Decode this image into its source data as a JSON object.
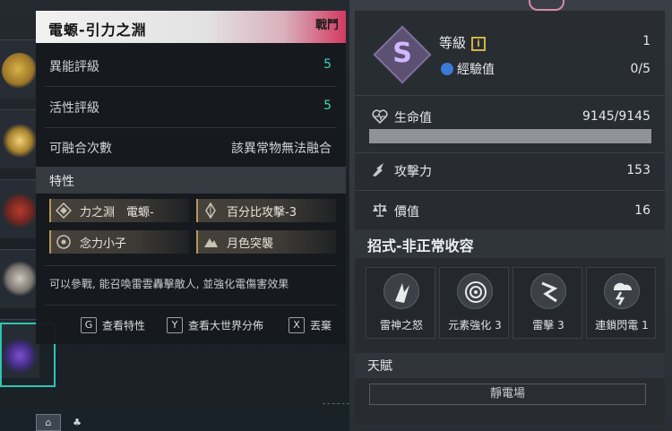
{
  "detail": {
    "title": "電螈-引力之淵",
    "tag": "戰鬥",
    "stats": [
      {
        "label": "異能評級",
        "value": "5"
      },
      {
        "label": "活性評級",
        "value": "5"
      },
      {
        "label": "可融合次數",
        "value": "該異常物無法融合"
      }
    ],
    "traits_heading": "特性",
    "traits": [
      {
        "label": "力之淵　電螈-",
        "icon": "diamond-icon"
      },
      {
        "label": "百分比攻擊-3",
        "icon": "crystal-icon"
      },
      {
        "label": "念力小子",
        "icon": "crosshair-icon"
      },
      {
        "label": "月色突襲",
        "icon": "mountain-icon"
      }
    ],
    "description": "可以參戰, 能召喚雷雲轟擊敵人, 並強化電傷害效果",
    "footer": [
      {
        "key": "G",
        "label": "查看特性"
      },
      {
        "key": "Y",
        "label": "查看大世界分佈"
      },
      {
        "key": "X",
        "label": "丟棄"
      }
    ]
  },
  "stats_panel": {
    "rank": "S",
    "level_label": "等級",
    "level_badge": "i",
    "level_value": "1",
    "xp_label": "經驗值",
    "xp_value": "0/5",
    "hp_label": "生命值",
    "hp_value": "9145/9145",
    "hp_fill": 1.0,
    "attack_label": "攻擊力",
    "attack_value": "153",
    "price_label": "價值",
    "price_value": "16",
    "moves_heading": "招式-非正常收容",
    "moves": [
      {
        "label": "雷神之怒",
        "icon": "thunder-god-icon"
      },
      {
        "label": "元素強化 3",
        "icon": "vortex-icon"
      },
      {
        "label": "雷擊 3",
        "icon": "lightning-icon"
      },
      {
        "label": "連鎖閃電 1",
        "icon": "chain-lightning-icon"
      }
    ],
    "talent_heading": "天賦",
    "talent_value": "靜電場"
  },
  "colors": {
    "accent_teal": "#3fd3bc",
    "header_red": "#d23a62",
    "rank_purple": "#d2b8ff",
    "trait_gold": "#b39a5a"
  }
}
